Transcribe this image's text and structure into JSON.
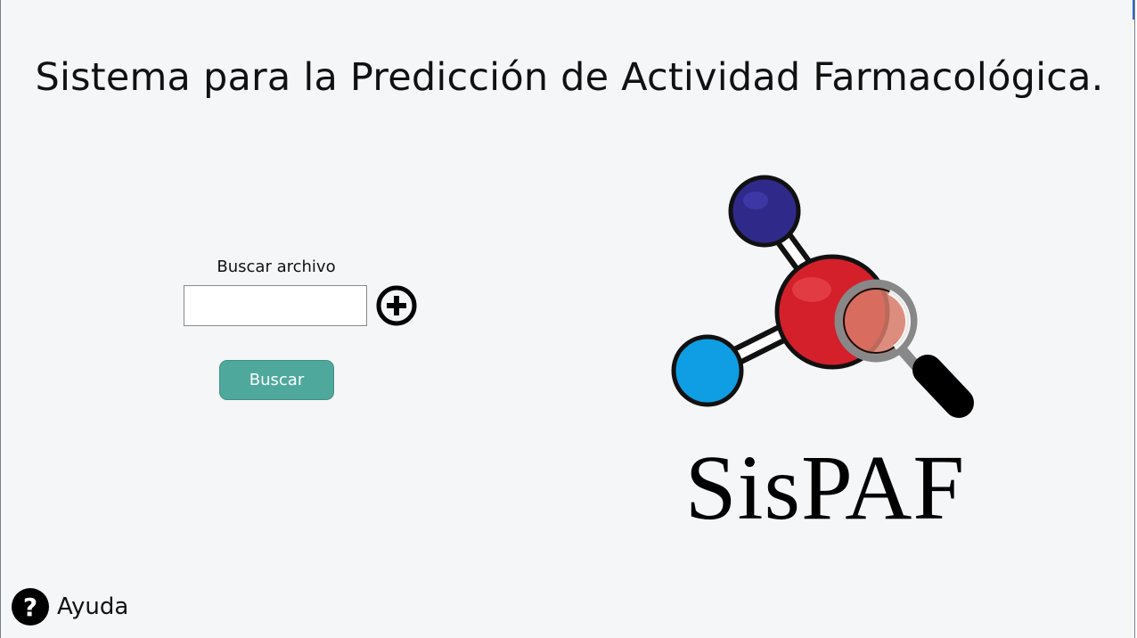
{
  "window": {
    "title": "Sistema para la Predicción de Actividad Farmacológica.",
    "background": "#f5f6f8"
  },
  "search": {
    "label": "Buscar archivo",
    "file_value": "",
    "placeholder": "",
    "add_icon": "plus-circle-icon",
    "button_label": "Buscar",
    "button_color": "#4ea99c"
  },
  "logo": {
    "text": "SisPAF",
    "icon": "molecule-magnifier-logo",
    "colors": {
      "top_atom": "#2f2a8a",
      "center_atom": "#d3202a",
      "left_atom": "#0f9ee3",
      "lens": "#888888"
    }
  },
  "help": {
    "icon": "question-circle-icon",
    "label": "Ayuda"
  }
}
